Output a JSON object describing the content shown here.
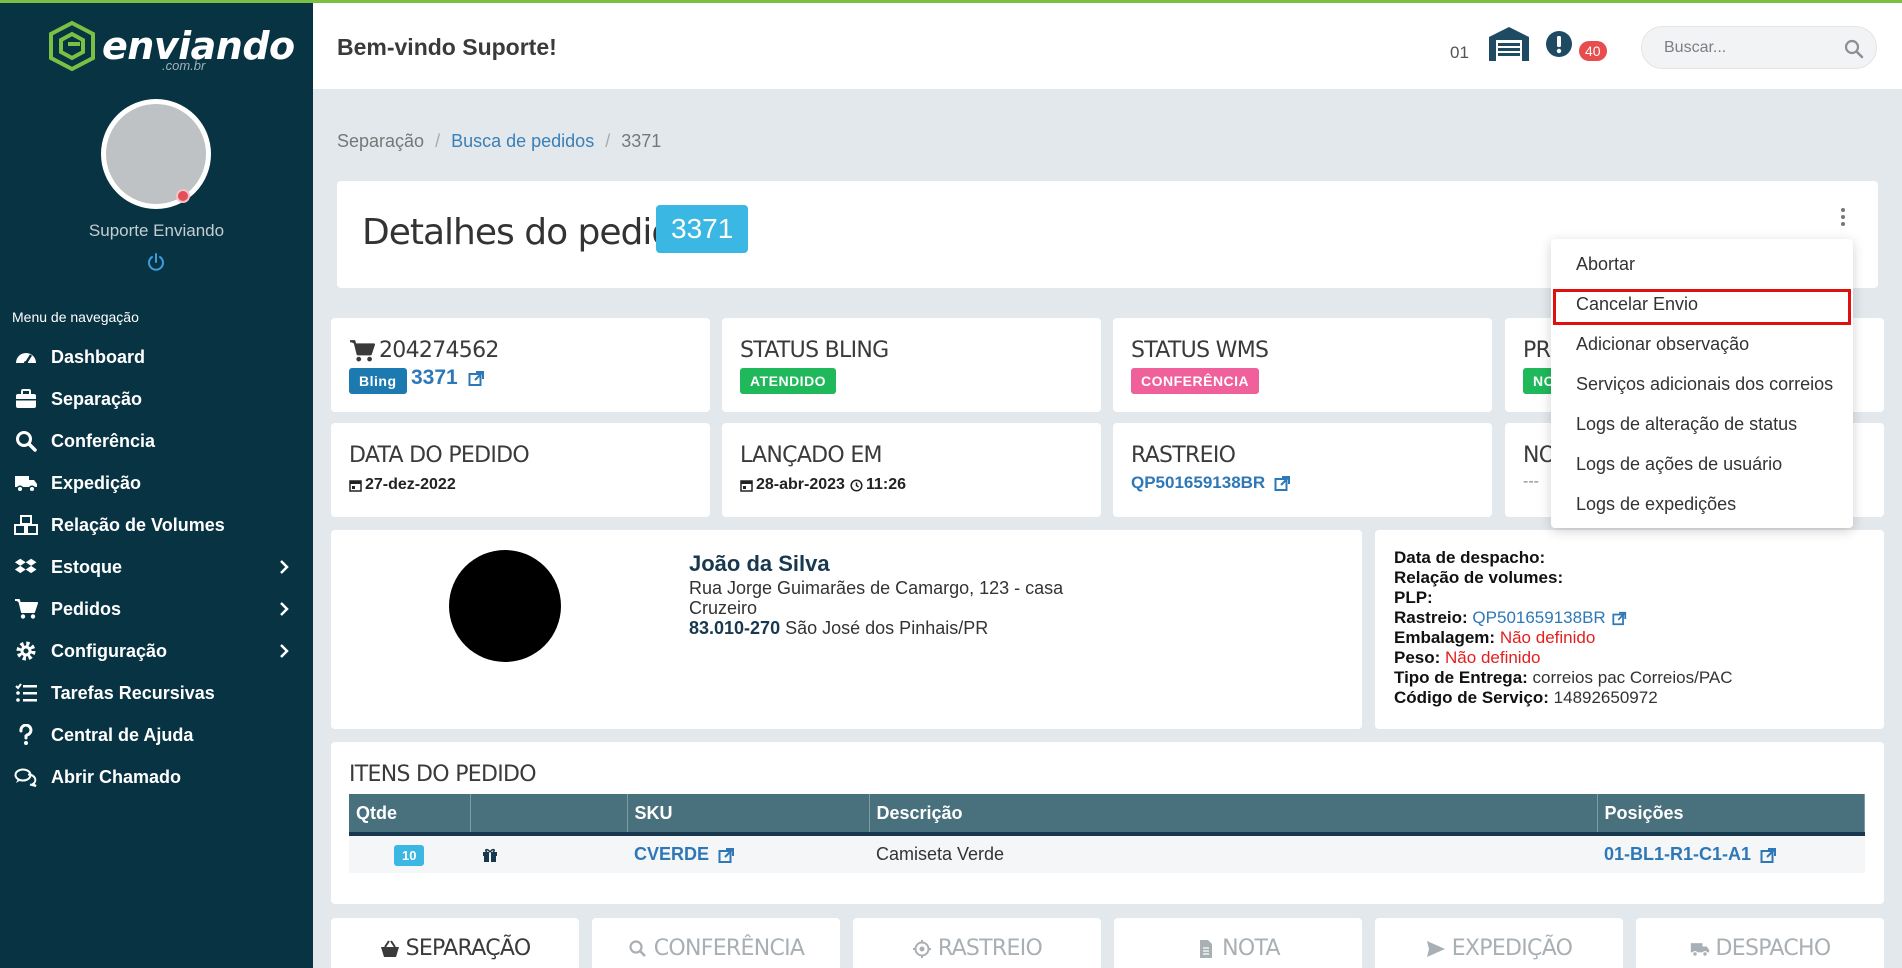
{
  "app": {
    "logo_text": "enviando",
    "logo_sub": ".com.br",
    "accent_color": "#7bc043",
    "sidebar_color": "#083342"
  },
  "sidebar": {
    "user_name": "Suporte Enviando",
    "nav_title": "Menu de navegação",
    "items": [
      {
        "label": "Dashboard",
        "icon": "gauge-icon"
      },
      {
        "label": "Separação",
        "icon": "briefcase-icon"
      },
      {
        "label": "Conferência",
        "icon": "search-icon"
      },
      {
        "label": "Expedição",
        "icon": "truck-icon"
      },
      {
        "label": "Relação de Volumes",
        "icon": "boxes-icon"
      },
      {
        "label": "Estoque",
        "icon": "dropbox-icon",
        "has_submenu": true
      },
      {
        "label": "Pedidos",
        "icon": "cart-icon",
        "has_submenu": true
      },
      {
        "label": "Configuração",
        "icon": "gear-icon",
        "has_submenu": true
      },
      {
        "label": "Tarefas Recursivas",
        "icon": "list-icon"
      },
      {
        "label": "Central de Ajuda",
        "icon": "question-icon"
      },
      {
        "label": "Abrir Chamado",
        "icon": "chat-icon"
      }
    ]
  },
  "header": {
    "welcome": "Bem-vindo Suporte!",
    "store_number": "01",
    "alert_count": "40",
    "search_placeholder": "Buscar..."
  },
  "breadcrumb": {
    "items": [
      "Separação",
      "Busca de pedidos",
      "3371"
    ]
  },
  "order": {
    "title": "Detalhes do pedido",
    "number": "3371",
    "cards": {
      "order_id": "204274562",
      "source_badge": "Bling",
      "source_link": "3371",
      "status_bling_label": "STATUS BLING",
      "status_bling_value": "ATENDIDO",
      "status_wms_label": "STATUS WMS",
      "status_wms_value": "CONFERÊNCIA",
      "card4_label_partial": "PR",
      "card4_badge_partial": "NO",
      "date_label": "DATA DO PEDIDO",
      "date_value": "27-dez-2022",
      "launched_label": "LANÇADO EM",
      "launched_date": "28-abr-2023",
      "launched_time": "11:26",
      "tracking_label": "RASTREIO",
      "tracking_value": "QP501659138BR",
      "card8_label_partial": "NO",
      "card8_value": "---"
    },
    "status_colors": {
      "atendido": "#1fb85a",
      "conferencia": "#f0609a",
      "bling": "#1c7ab0"
    }
  },
  "customer": {
    "name": "João da Silva",
    "address": "Rua Jorge Guimarães de Camargo, 123 - casa",
    "district": "Cruzeiro",
    "zip": "83.010-270",
    "city": "São José dos Pinhais/PR"
  },
  "shipping": {
    "dispatch_label": "Data de despacho:",
    "volumes_label": "Relação de volumes:",
    "plp_label": "PLP:",
    "tracking_label": "Rastreio:",
    "tracking_value": "QP501659138BR",
    "package_label": "Embalagem:",
    "package_value": "Não definido",
    "weight_label": "Peso:",
    "weight_value": "Não definido",
    "delivery_label": "Tipo de Entrega:",
    "delivery_value": "correios pac Correios/PAC",
    "service_label": "Código de Serviço:",
    "service_value": "14892650972"
  },
  "items": {
    "title": "ITENS DO PEDIDO",
    "columns": [
      "Qtde",
      "",
      "SKU",
      "Descrição",
      "Posições"
    ],
    "rows": [
      {
        "qty": "10",
        "sku": "CVERDE",
        "description": "Camiseta Verde",
        "position": "01-BL1-R1-C1-A1"
      }
    ]
  },
  "tabs": [
    "SEPARAÇÃO",
    "CONFERÊNCIA",
    "RASTREIO",
    "NOTA",
    "EXPEDIÇÃO",
    "DESPACHO"
  ],
  "dropdown": {
    "items": [
      "Abortar",
      "Cancelar Envio",
      "Adicionar observação",
      "Serviços adicionais dos correios",
      "Logs de alteração de status",
      "Logs de ações de usuário",
      "Logs de expedições"
    ],
    "highlighted": "Cancelar Envio",
    "highlight_color": "#e01010"
  }
}
